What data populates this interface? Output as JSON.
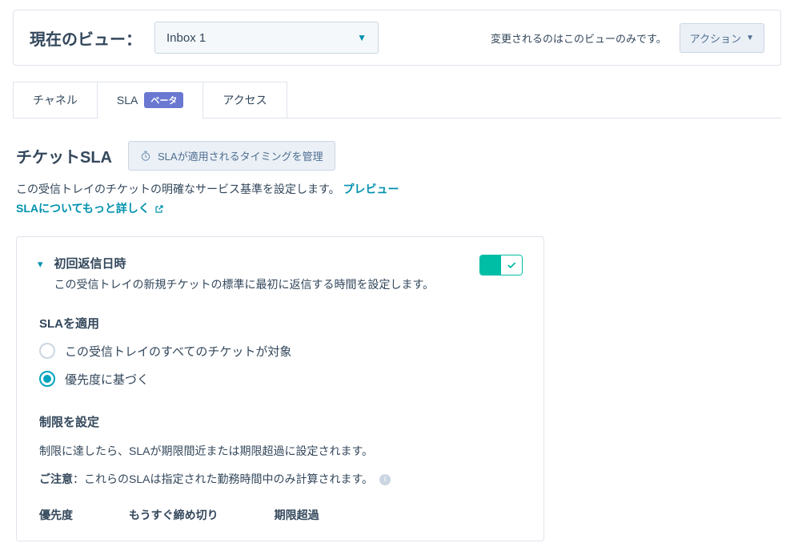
{
  "viewBar": {
    "label": "現在のビュー：",
    "selected": "Inbox 1",
    "note": "変更されるのはこのビューのみです。",
    "actionLabel": "アクション"
  },
  "tabs": {
    "channel": "チャネル",
    "sla": "SLA",
    "slaBadge": "ベータ",
    "access": "アクセス"
  },
  "section": {
    "title": "チケットSLA",
    "timingButton": "SLAが適用されるタイミングを管理",
    "descLine1": "この受信トレイのチケットの明確なサービス基準を設定します。",
    "previewLink": "プレビュー",
    "learnMore": "SLAについてもっと詳しく"
  },
  "panel": {
    "title": "初回返信日時",
    "subtitle": "この受信トレイの新規チケットの標準に最初に返信する時間を設定します。",
    "toggleOn": true,
    "applyHead": "SLAを適用",
    "radio": {
      "all": "この受信トレイのすべてのチケットが対象",
      "priority": "優先度に基づく",
      "selected": "priority"
    },
    "limitsHead": "制限を設定",
    "limitsDesc": "制限に達したら、SLAが期限間近または期限超過に設定されます。",
    "noticePrefix": "ご注意",
    "noticeColon": "：",
    "noticeText": "これらのSLAは指定された勤務時間中のみ計算されます。",
    "cols": {
      "priority": "優先度",
      "dueSoon": "もうすぐ締め切り",
      "overdue": "期限超過"
    }
  }
}
